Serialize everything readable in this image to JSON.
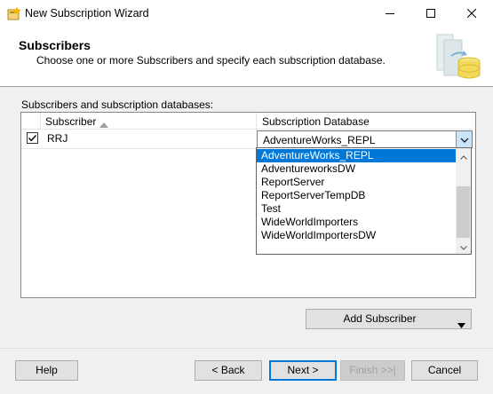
{
  "window": {
    "title": "New Subscription Wizard"
  },
  "header": {
    "title": "Subscribers",
    "subtitle": "Choose one or more Subscribers and specify each subscription database."
  },
  "grid": {
    "label": "Subscribers and subscription databases:",
    "columns": [
      "Subscriber",
      "Subscription Database"
    ],
    "rows": [
      {
        "checked": true,
        "subscriber": "RRJ",
        "database": "AdventureWorks_REPL"
      }
    ]
  },
  "dropdown": {
    "selected": "AdventureWorks_REPL",
    "options": [
      "AdventureWorks_REPL",
      "AdventureworksDW",
      "ReportServer",
      "ReportServerTempDB",
      "Test",
      "WideWorldImporters",
      "WideWorldImportersDW"
    ]
  },
  "buttons": {
    "add_subscriber": "Add Subscriber",
    "help": "Help",
    "back": "< Back",
    "next": "Next >",
    "finish": "Finish >>|",
    "cancel": "Cancel"
  },
  "colors": {
    "selection": "#0078d7",
    "dialog_bg": "#f0f0f0"
  }
}
